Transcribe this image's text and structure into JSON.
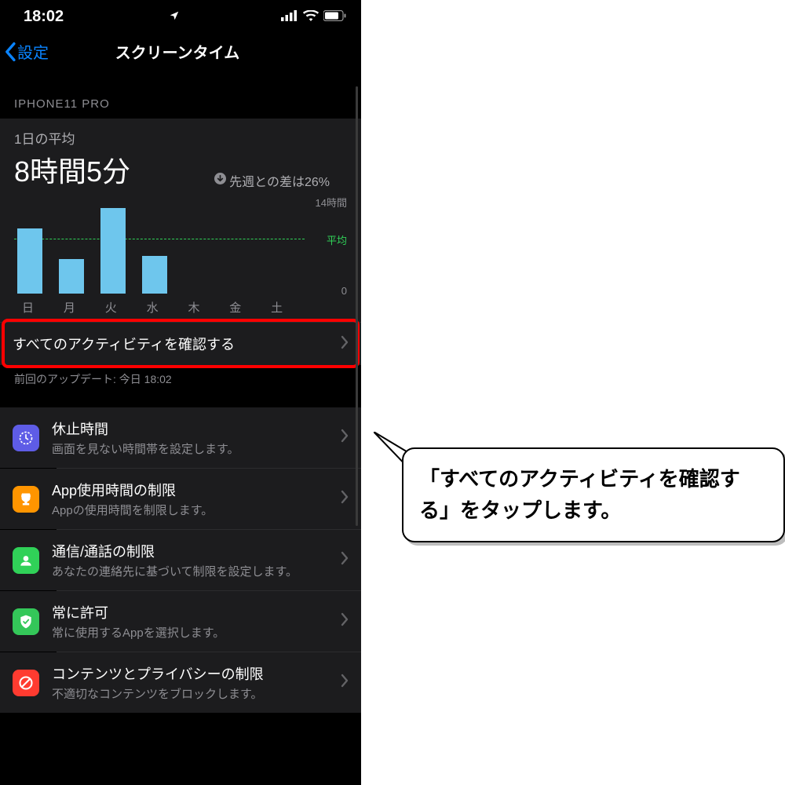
{
  "status": {
    "time": "18:02"
  },
  "nav": {
    "back": "設定",
    "title": "スクリーンタイム"
  },
  "device_label": "IPHONE11 PRO",
  "summary": {
    "avg_label": "1日の平均",
    "avg_value": "8時間5分",
    "diff_text": "先週との差は26%"
  },
  "chart_data": {
    "type": "bar",
    "categories": [
      "日",
      "月",
      "火",
      "水",
      "木",
      "金",
      "土"
    ],
    "values": [
      9.5,
      5,
      12.5,
      5.5,
      0,
      0,
      0
    ],
    "avg_value": 8.08,
    "ylim": [
      0,
      14
    ],
    "ylabel_top": "14時間",
    "ylabel_bottom": "0",
    "avg_line_label": "平均"
  },
  "activity_row": {
    "label": "すべてのアクティビティを確認する"
  },
  "last_update": "前回のアップデート: 今日 18:02",
  "menu": [
    {
      "icon": "downtime",
      "title": "休止時間",
      "sub": "画面を見ない時間帯を設定します。"
    },
    {
      "icon": "app-limits",
      "title": "App使用時間の制限",
      "sub": "Appの使用時間を制限します。"
    },
    {
      "icon": "comm",
      "title": "通信/通話の制限",
      "sub": "あなたの連絡先に基づいて制限を設定します。"
    },
    {
      "icon": "allow",
      "title": "常に許可",
      "sub": "常に使用するAppを選択します。"
    },
    {
      "icon": "content",
      "title": "コンテンツとプライバシーの制限",
      "sub": "不適切なコンテンツをブロックします。"
    }
  ],
  "callout": "「すべてのアクティビティを確認する」をタップします。"
}
